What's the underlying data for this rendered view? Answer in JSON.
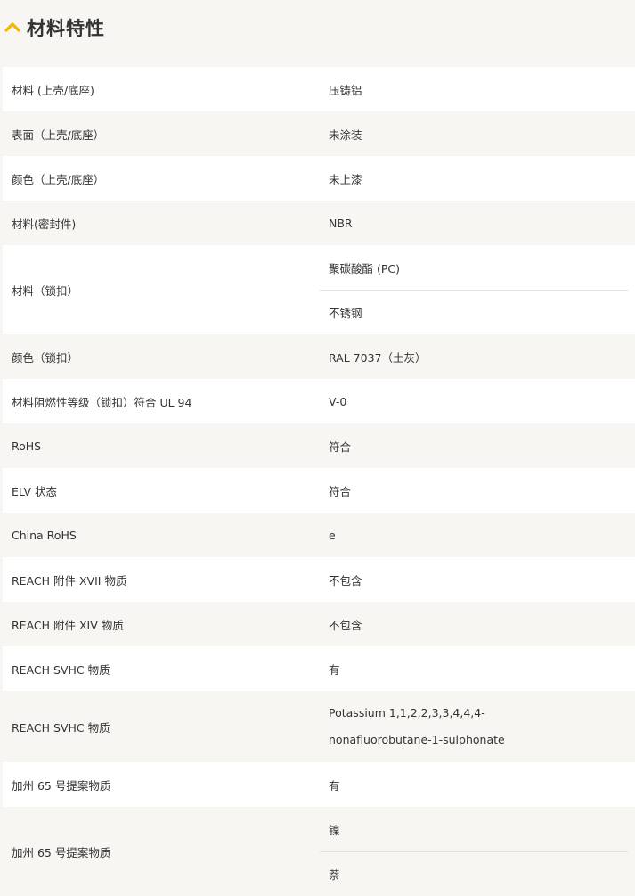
{
  "header": {
    "title": "材料特性"
  },
  "rows": [
    {
      "label": "材料 (上壳/底座)",
      "values": [
        "压铸铝"
      ]
    },
    {
      "label": "表面（上壳/底座）",
      "values": [
        "未涂装"
      ]
    },
    {
      "label": "颜色（上壳/底座）",
      "values": [
        "未上漆"
      ]
    },
    {
      "label": "材料(密封件)",
      "values": [
        "NBR"
      ]
    },
    {
      "label": "材料（锁扣）",
      "values": [
        "聚碳酸酯 (PC)",
        "不锈钢"
      ]
    },
    {
      "label": "颜色（锁扣）",
      "values": [
        "RAL 7037（土灰）"
      ]
    },
    {
      "label": "材料阻燃性等级（锁扣）符合 UL 94",
      "values": [
        "V-0"
      ]
    },
    {
      "label": "RoHS",
      "values": [
        "符合"
      ]
    },
    {
      "label": "ELV 状态",
      "values": [
        "符合"
      ]
    },
    {
      "label": "China RoHS",
      "values": [
        "e"
      ]
    },
    {
      "label": "REACH 附件 XVII 物质",
      "values": [
        "不包含"
      ]
    },
    {
      "label": "REACH 附件 XIV 物质",
      "values": [
        "不包含"
      ]
    },
    {
      "label": "REACH SVHC 物质",
      "values": [
        "有"
      ]
    },
    {
      "label": "REACH SVHC 物质",
      "values": [
        "Potassium 1,1,2,2,3,3,4,4,4-nonafluorobutane-1-sulphonate"
      ]
    },
    {
      "label": "加州 65 号提案物质",
      "values": [
        "有"
      ]
    },
    {
      "label": "加州 65 号提案物质",
      "values": [
        "镍",
        "萘"
      ]
    }
  ]
}
